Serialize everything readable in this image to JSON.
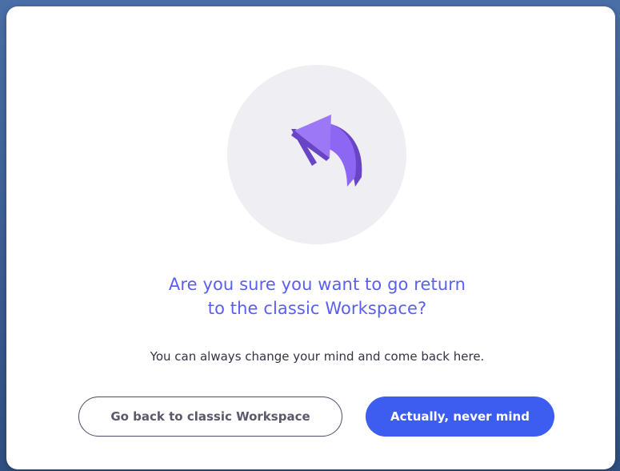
{
  "dialog": {
    "icon": "return-arrow-icon",
    "title_line1": "Are you sure you want to go return",
    "title_line2": "to the classic Workspace?",
    "subtitle": "You can always change your mind and come back here.",
    "secondary_button_label": "Go back to classic Workspace",
    "primary_button_label": "Actually, never mind"
  },
  "colors": {
    "accent": "#5a5ff3",
    "primary_button": "#3d5cf0",
    "icon_purple": "#8b63f2",
    "illustration_bg": "#eeeef3"
  }
}
